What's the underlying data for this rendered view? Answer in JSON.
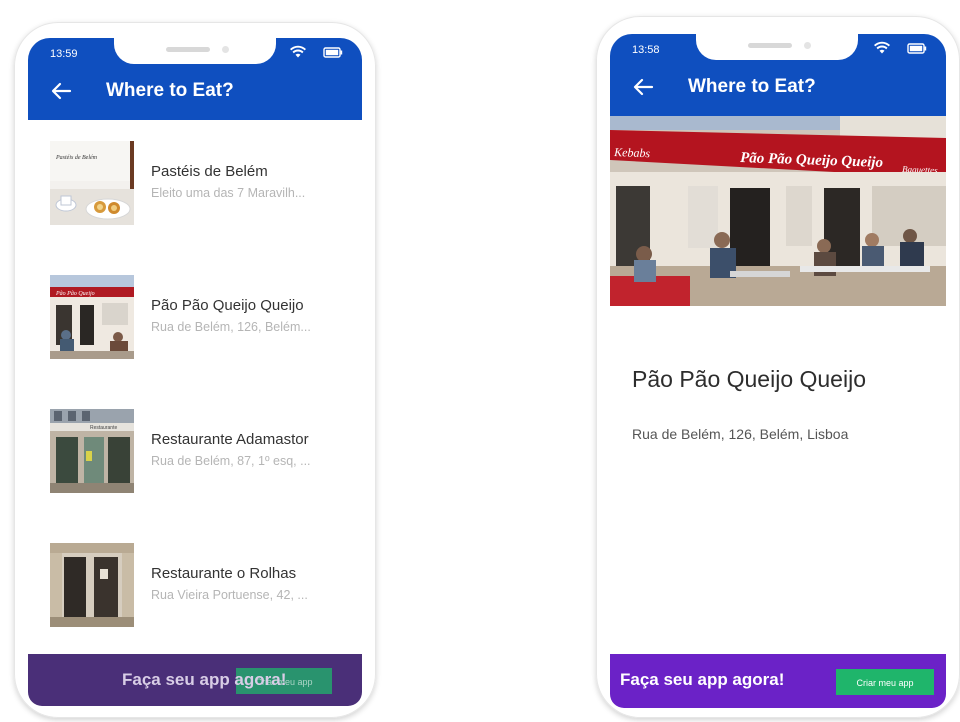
{
  "left_phone": {
    "status_time": "13:59",
    "appbar": {
      "title": "Where to Eat?"
    },
    "items": [
      {
        "title": "Pastéis de Belém",
        "subtitle": "Eleito uma das 7 Maravilh...",
        "thumb_caption": "Pastéis de Belém"
      },
      {
        "title": "Pão Pão Queijo Queijo",
        "subtitle": "Rua de Belém, 126, Belém...",
        "thumb_caption": "Pão Pão Queijo"
      },
      {
        "title": "Restaurante Adamastor",
        "subtitle": "Rua de Belém, 87, 1º esq, ...",
        "thumb_caption": "Restaurante"
      },
      {
        "title": "Restaurante o Rolhas",
        "subtitle": "Rua Vieira Portuense, 42, ...",
        "thumb_caption": ""
      }
    ],
    "banner": {
      "text": "Faça seu app agora!",
      "button_label": "Criar meu app"
    }
  },
  "right_phone": {
    "status_time": "13:58",
    "appbar": {
      "title": "Where to Eat?"
    },
    "hero": {
      "sign_left": "Kebabs",
      "sign_main": "Pão Pão Queijo Queijo",
      "sign_right": "Baguettes"
    },
    "detail": {
      "title": "Pão Pão Queijo Queijo",
      "address": "Rua de Belém, 126, Belém, Lisboa"
    },
    "banner": {
      "text": "Faça seu app agora!",
      "button_label": "Criar meu app"
    }
  },
  "colors": {
    "appbar": "#0f4fbf",
    "banner_left": "#4a2f78",
    "banner_right": "#6b22c7",
    "button": "#1fb56b"
  }
}
